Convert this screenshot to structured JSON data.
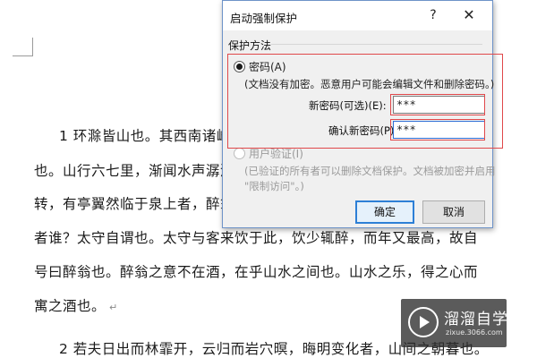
{
  "document": {
    "lines": [
      "1 环滁皆山也。其西南诸峰",
      "也。山行六七里，渐闻水声潺潺",
      "转，有亭翼然临于泉上者，醉翁",
      "者谁？太守自谓也。太守与客来饮于此，饮少辄醉，而年又最高，故自",
      "号曰醉翁也。醉翁之意不在酒，在乎山水之间也。山水之乐，得之心而",
      "寓之酒也。",
      "2 若夫日出而林霏开，云归而岩穴暝，晦明变化者，山间之朝暮也。"
    ],
    "paragraph_mark": "↵"
  },
  "dialog": {
    "title": "启动强制保护",
    "help": "?",
    "close": "✕",
    "section_label": "保护方法",
    "password_option": "密码(A)",
    "password_desc": "(文档没有加密。恶意用户可能会编辑文件和删除密码。)",
    "new_password_label": "新密码(可选)(E):",
    "new_password_value": "***",
    "confirm_password_label": "确认新密码(P):",
    "confirm_password_value": "***",
    "user_auth_option": "用户验证(I)",
    "user_auth_desc_1": "(已验证的所有者可以删除文档保护。文档被加密并启用",
    "user_auth_desc_2": "\"限制访问\"。)",
    "ok_label": "确定",
    "cancel_label": "取消"
  },
  "watermark": {
    "title": "溜溜自学",
    "subtitle": "zixue.3066.com"
  },
  "colors": {
    "annotation_red": "#e0484a",
    "dialog_border": "#6e93c8",
    "default_button_border": "#2d7fd6"
  }
}
